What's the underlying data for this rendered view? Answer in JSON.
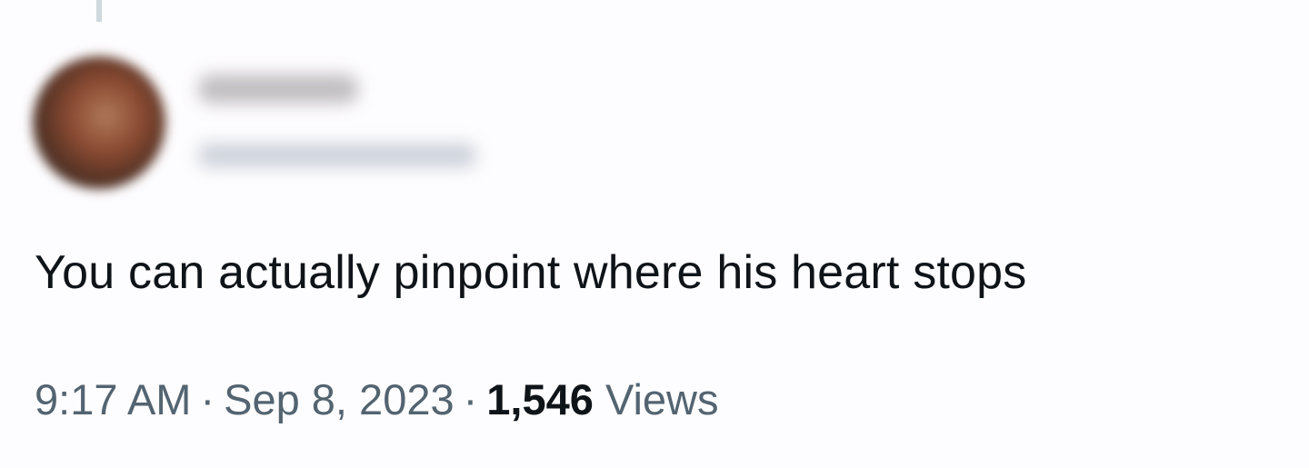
{
  "author": {
    "avatar": "profile-avatar-blurred",
    "display_name": "",
    "handle": ""
  },
  "tweet": {
    "text": "You can actually pinpoint where his heart stops",
    "time": "9:17 AM",
    "separator": "·",
    "date": "Sep 8, 2023",
    "views_count": "1,546",
    "views_label": "Views"
  },
  "colors": {
    "text": "#0f1419",
    "secondary": "#536471",
    "thread_line": "#cfd9de",
    "background": "#fdfcfe"
  }
}
